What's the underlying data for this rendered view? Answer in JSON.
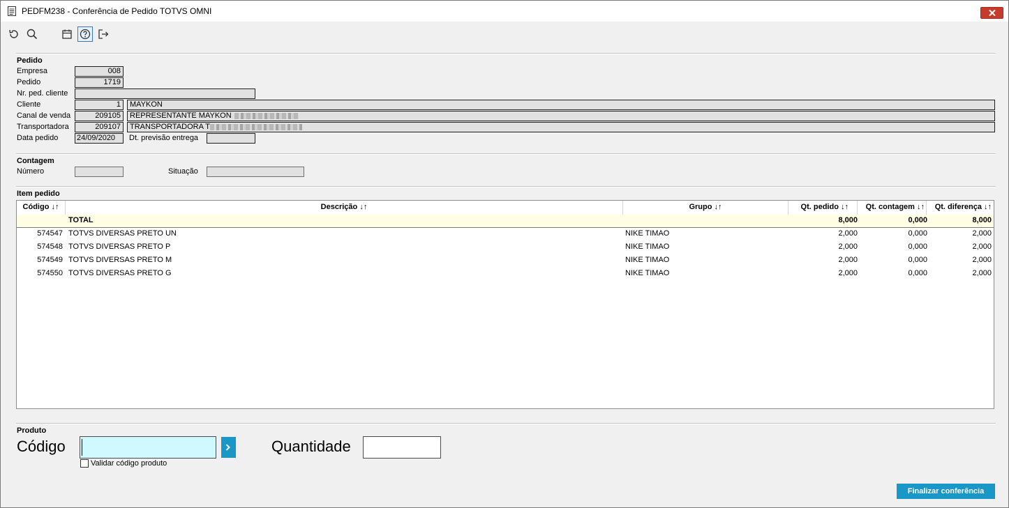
{
  "window": {
    "title": "PEDFM238 - Conferência de Pedido TOTVS OMNI"
  },
  "toolbar": {
    "icons": [
      "refresh-icon",
      "search-icon",
      "calendar-icon",
      "help-icon",
      "exit-icon"
    ]
  },
  "pedido": {
    "section": "Pedido",
    "empresa_label": "Empresa",
    "empresa": "008",
    "pedido_label": "Pedido",
    "pedido": "1719",
    "nr_ped_label": "Nr. ped. cliente",
    "nr_ped": "",
    "cliente_label": "Cliente",
    "cliente_code": "1",
    "cliente_name": "MAYKON",
    "canal_label": "Canal de venda",
    "canal_code": "209105",
    "canal_name": "REPRESENTANTE MAYKON",
    "transp_label": "Transportadora",
    "transp_code": "209107",
    "transp_name": "TRANSPORTADORA T",
    "data_label": "Data pedido",
    "data": "24/09/2020",
    "prev_label": "Dt. previsão entrega",
    "prev": ""
  },
  "contagem": {
    "section": "Contagem",
    "numero_label": "Número",
    "numero": "",
    "situacao_label": "Situação",
    "situacao": ""
  },
  "items": {
    "section": "Item pedido",
    "headers": {
      "codigo": "Código ↓↑",
      "descricao": "Descrição ↓↑",
      "grupo": "Grupo ↓↑",
      "qt_pedido": "Qt. pedido ↓↑",
      "qt_contagem": "Qt. contagem ↓↑",
      "qt_diferenca": "Qt. diferença ↓↑"
    },
    "total": {
      "label": "TOTAL",
      "qt_pedido": "8,000",
      "qt_contagem": "0,000",
      "qt_diferenca": "8,000"
    },
    "rows": [
      {
        "codigo": "574547",
        "descricao": "TOTVS DIVERSAS PRETO UN",
        "grupo": "NIKE TIMAO",
        "qt_pedido": "2,000",
        "qt_contagem": "0,000",
        "qt_diferenca": "2,000"
      },
      {
        "codigo": "574548",
        "descricao": "TOTVS DIVERSAS PRETO P",
        "grupo": "NIKE TIMAO",
        "qt_pedido": "2,000",
        "qt_contagem": "0,000",
        "qt_diferenca": "2,000"
      },
      {
        "codigo": "574549",
        "descricao": "TOTVS DIVERSAS PRETO M",
        "grupo": "NIKE TIMAO",
        "qt_pedido": "2,000",
        "qt_contagem": "0,000",
        "qt_diferenca": "2,000"
      },
      {
        "codigo": "574550",
        "descricao": "TOTVS DIVERSAS PRETO G",
        "grupo": "NIKE TIMAO",
        "qt_pedido": "2,000",
        "qt_contagem": "0,000",
        "qt_diferenca": "2,000"
      }
    ]
  },
  "produto": {
    "section": "Produto",
    "codigo_label": "Código",
    "codigo_value": "",
    "quantidade_label": "Quantidade",
    "quantidade_value": "",
    "validar_label": "Validar código produto",
    "validar_checked": false,
    "finalizar_label": "Finalizar conferência"
  },
  "colors": {
    "accent": "#1997c6",
    "close": "#c73b2d",
    "input_highlight": "#cff8ff",
    "total_row": "#fffde3"
  }
}
